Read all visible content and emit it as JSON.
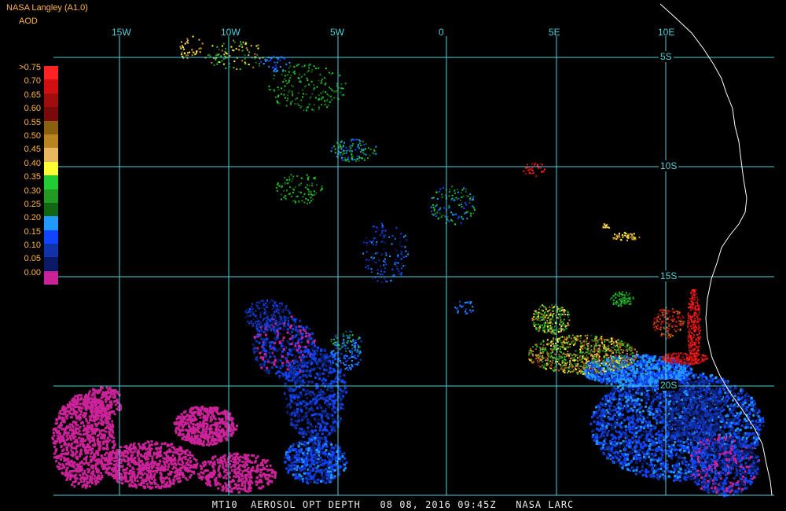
{
  "header": {
    "source": "NASA Langley (A1.0)",
    "product": "AOD"
  },
  "legend": {
    "labels": [
      ">0.75",
      "0.70",
      "0.65",
      "0.60",
      "0.55",
      "0.50",
      "0.45",
      "0.40",
      "0.35",
      "0.30",
      "0.25",
      "0.20",
      "0.15",
      "0.10",
      "0.05",
      "0.00"
    ],
    "colors": [
      "#ff2222",
      "#d01010",
      "#a00d0d",
      "#7a0a0a",
      "#8a6010",
      "#b88420",
      "#e8b860",
      "#ffff33",
      "#22cc33",
      "#229922",
      "#116611",
      "#2299ff",
      "#1144ff",
      "#1133aa",
      "#0a1a66",
      "#cc2299"
    ]
  },
  "lon_labels": [
    "15W",
    "10W",
    "5W",
    "0",
    "5E",
    "10E"
  ],
  "lat_labels": [
    "5S",
    "10S",
    "15S",
    "20S"
  ],
  "footer": {
    "text": "MT10  AEROSOL OPT DEPTH   08 08, 2016 09:45Z   NASA LARC"
  },
  "colors": {
    "grid": "#4fd1d9",
    "coast": "#ffffff",
    "background": "#000000"
  }
}
